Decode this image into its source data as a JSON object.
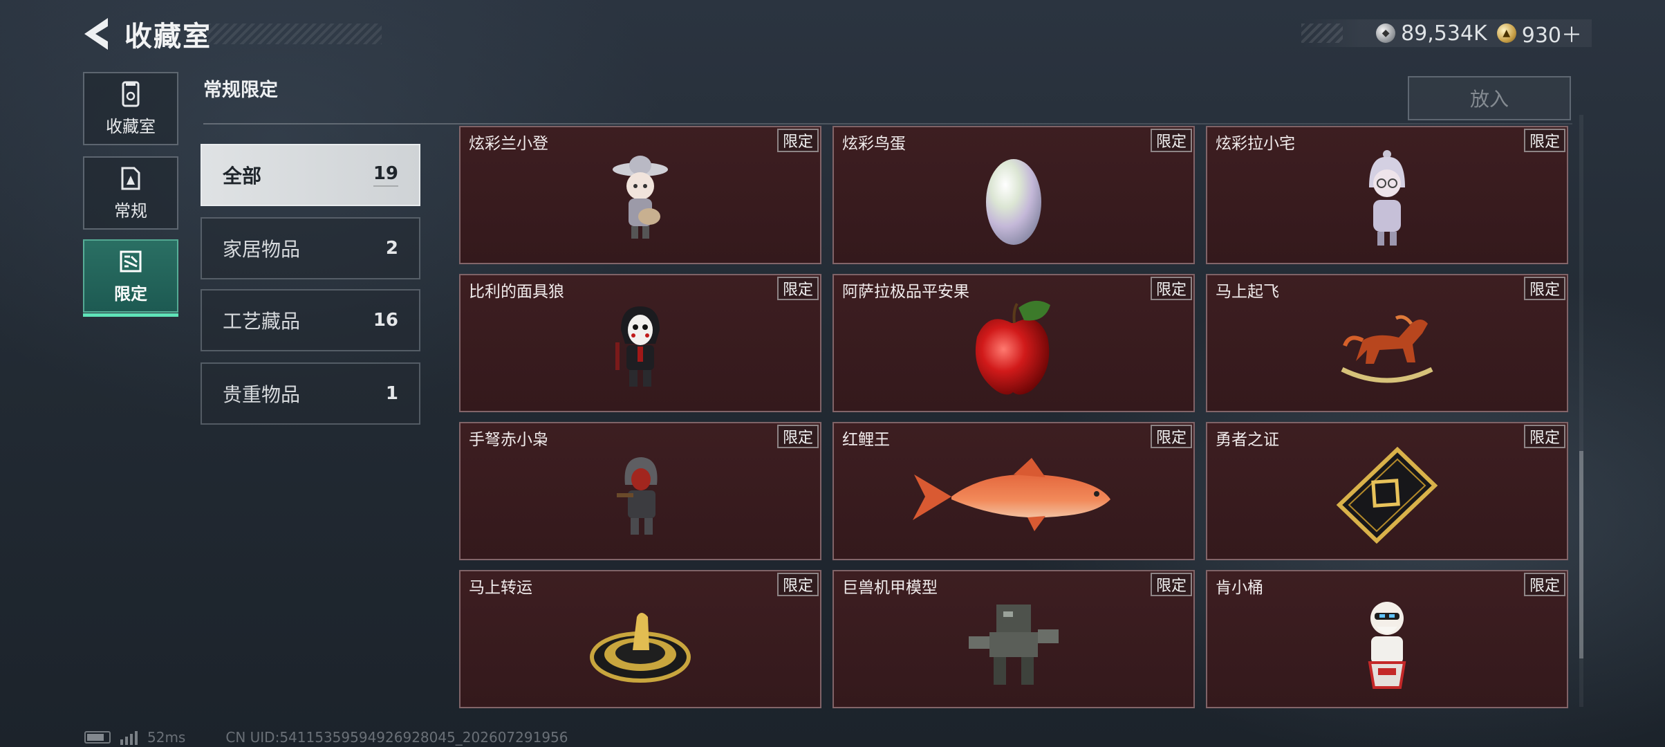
{
  "header": {
    "title": "收藏室",
    "currencies": [
      {
        "icon": "silver-coin-icon",
        "value": "89,534K"
      },
      {
        "icon": "gold-coin-icon",
        "value": "930＋"
      }
    ]
  },
  "nav": {
    "items": [
      {
        "label": "收藏室",
        "icon": "collection-icon",
        "active": false
      },
      {
        "label": "常规",
        "icon": "regular-icon",
        "active": false
      },
      {
        "label": "限定",
        "icon": "limited-icon",
        "active": true
      }
    ]
  },
  "section": {
    "title": "常规限定"
  },
  "categories": [
    {
      "label": "全部",
      "count": "19",
      "selected": true
    },
    {
      "label": "家居物品",
      "count": "2",
      "selected": false
    },
    {
      "label": "工艺藏品",
      "count": "16",
      "selected": false
    },
    {
      "label": "贵重物品",
      "count": "1",
      "selected": false
    }
  ],
  "actions": {
    "put_in": "放入"
  },
  "tag_label": "限定",
  "items": [
    {
      "name": "炫彩兰小登",
      "tag": "限定",
      "icon": "sombrero-doll-figurine-icon"
    },
    {
      "name": "炫彩鸟蛋",
      "tag": "限定",
      "icon": "iridescent-egg-icon"
    },
    {
      "name": "炫彩拉小宅",
      "tag": "限定",
      "icon": "hooded-doll-figurine-icon"
    },
    {
      "name": "比利的面具狼",
      "tag": "限定",
      "icon": "masked-puppet-figurine-icon"
    },
    {
      "name": "阿萨拉极品平安果",
      "tag": "限定",
      "icon": "red-apple-icon"
    },
    {
      "name": "马上起飞",
      "tag": "限定",
      "icon": "rocking-horse-icon"
    },
    {
      "name": "手弩赤小枭",
      "tag": "限定",
      "icon": "hooded-archer-figurine-icon"
    },
    {
      "name": "红鲤王",
      "tag": "限定",
      "icon": "red-carp-icon"
    },
    {
      "name": "勇者之证",
      "tag": "限定",
      "icon": "gold-card-icon"
    },
    {
      "name": "马上转运",
      "tag": "限定",
      "icon": "golden-disc-icon"
    },
    {
      "name": "巨兽机甲模型",
      "tag": "限定",
      "icon": "mech-model-icon"
    },
    {
      "name": "肯小桶",
      "tag": "限定",
      "icon": "colonel-figurine-icon"
    }
  ],
  "footer": {
    "ping": "52ms",
    "uid": "CN UID:54115359594926928045_202607291956",
    "battery_level": 0.8
  }
}
